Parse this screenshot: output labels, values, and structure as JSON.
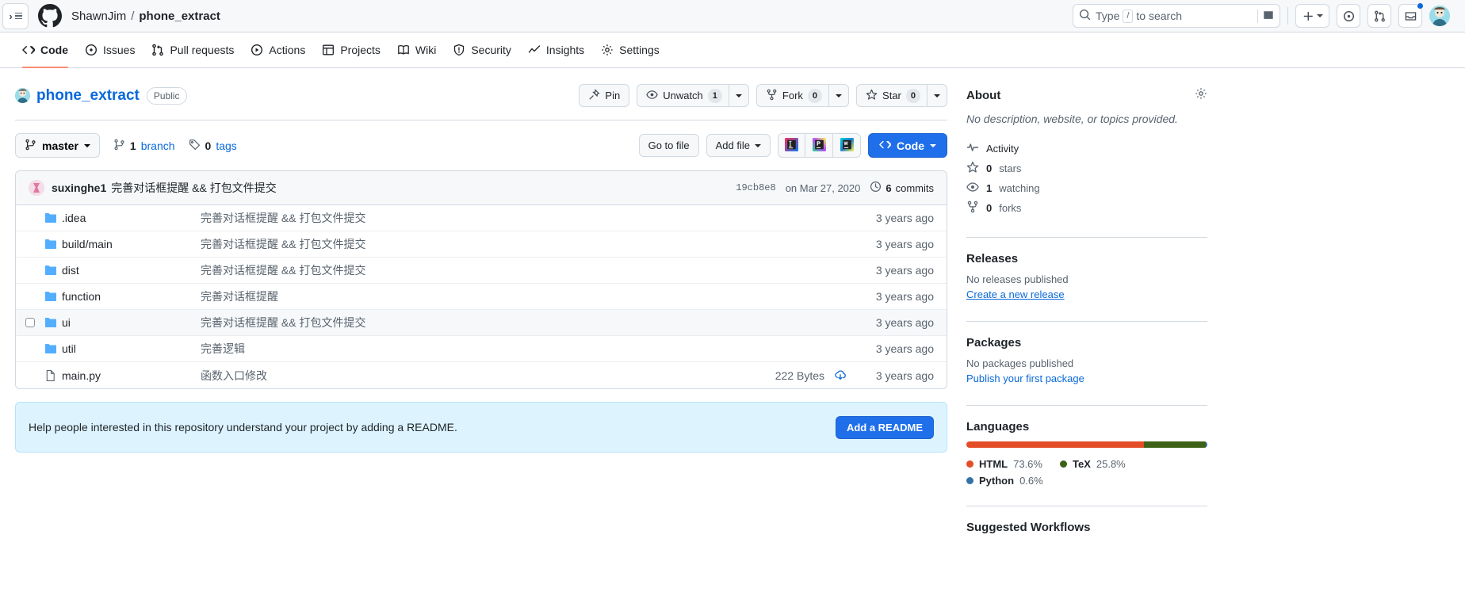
{
  "topbar": {
    "owner": "ShawnJim",
    "separator": "/",
    "repo": "phone_extract",
    "search_placeholder_pre": "Type",
    "search_slash_key": "/",
    "search_placeholder_post": "to search"
  },
  "repo_nav": [
    {
      "label": "Code",
      "icon": "code-icon",
      "active": true
    },
    {
      "label": "Issues",
      "icon": "issue-opened-icon",
      "active": false
    },
    {
      "label": "Pull requests",
      "icon": "git-pull-request-icon",
      "active": false
    },
    {
      "label": "Actions",
      "icon": "play-icon",
      "active": false
    },
    {
      "label": "Projects",
      "icon": "table-icon",
      "active": false
    },
    {
      "label": "Wiki",
      "icon": "book-icon",
      "active": false
    },
    {
      "label": "Security",
      "icon": "shield-icon",
      "active": false
    },
    {
      "label": "Insights",
      "icon": "graph-icon",
      "active": false
    },
    {
      "label": "Settings",
      "icon": "gear-icon",
      "active": false
    }
  ],
  "repo_header": {
    "name": "phone_extract",
    "visibility": "Public",
    "pin_label": "Pin",
    "watch_label": "Unwatch",
    "watch_count": "1",
    "fork_label": "Fork",
    "fork_count": "0",
    "star_label": "Star",
    "star_count": "0"
  },
  "file_toolbar": {
    "branch": "master",
    "branch_count": "1",
    "branch_word": "branch",
    "tag_count": "0",
    "tag_word": "tags",
    "go_to_file": "Go to file",
    "add_file": "Add file",
    "code_label": "Code",
    "ide_buttons": [
      "intellij-idea-icon",
      "pycharm-icon",
      "webstorm-icon"
    ]
  },
  "latest_commit": {
    "author": "suxinghe1",
    "message": "完善对话框提醒 && 打包文件提交",
    "sha": "19cb8e8",
    "date": "on Mar 27, 2020",
    "commit_count": "6",
    "commit_word": "commits"
  },
  "files": [
    {
      "type": "folder",
      "name": ".idea",
      "message": "完善对话框提醒 && 打包文件提交",
      "size": "",
      "time": "3 years ago",
      "hovered": false
    },
    {
      "type": "folder",
      "name": "build/main",
      "name_bold": "main",
      "message": "完善对话框提醒 && 打包文件提交",
      "size": "",
      "time": "3 years ago",
      "hovered": false
    },
    {
      "type": "folder",
      "name": "dist",
      "message": "完善对话框提醒 && 打包文件提交",
      "size": "",
      "time": "3 years ago",
      "hovered": false
    },
    {
      "type": "folder",
      "name": "function",
      "message": "完善对话框提醒",
      "size": "",
      "time": "3 years ago",
      "hovered": false
    },
    {
      "type": "folder",
      "name": "ui",
      "message": "完善对话框提醒 && 打包文件提交",
      "size": "",
      "time": "3 years ago",
      "hovered": true
    },
    {
      "type": "folder",
      "name": "util",
      "message": "完善逻辑",
      "size": "",
      "time": "3 years ago",
      "hovered": false
    },
    {
      "type": "file",
      "name": "main.py",
      "message": "函数入口修改",
      "size": "222 Bytes",
      "time": "3 years ago",
      "hovered": false
    }
  ],
  "readme_banner": {
    "text": "Help people interested in this repository understand your project by adding a README.",
    "button": "Add a README"
  },
  "about": {
    "heading": "About",
    "description": "No description, website, or topics provided.",
    "rows": [
      {
        "icon": "pulse-icon",
        "label": "Activity",
        "value": ""
      },
      {
        "icon": "star-icon",
        "value": "0",
        "label": "stars"
      },
      {
        "icon": "eye-icon",
        "value": "1",
        "label": "watching"
      },
      {
        "icon": "repo-forked-icon",
        "value": "0",
        "label": "forks"
      }
    ]
  },
  "releases": {
    "heading": "Releases",
    "empty": "No releases published",
    "link": "Create a new release"
  },
  "packages": {
    "heading": "Packages",
    "empty": "No packages published",
    "link": "Publish your first package"
  },
  "languages": {
    "heading": "Languages",
    "items": [
      {
        "name": "HTML",
        "percent": "73.6%",
        "color": "#e34c26",
        "width": "73.6"
      },
      {
        "name": "TeX",
        "percent": "25.8%",
        "color": "#3D6117",
        "width": "25.8"
      },
      {
        "name": "Python",
        "percent": "0.6%",
        "color": "#3572A5",
        "width": "0.6"
      }
    ]
  },
  "workflows": {
    "heading": "Suggested Workflows"
  }
}
